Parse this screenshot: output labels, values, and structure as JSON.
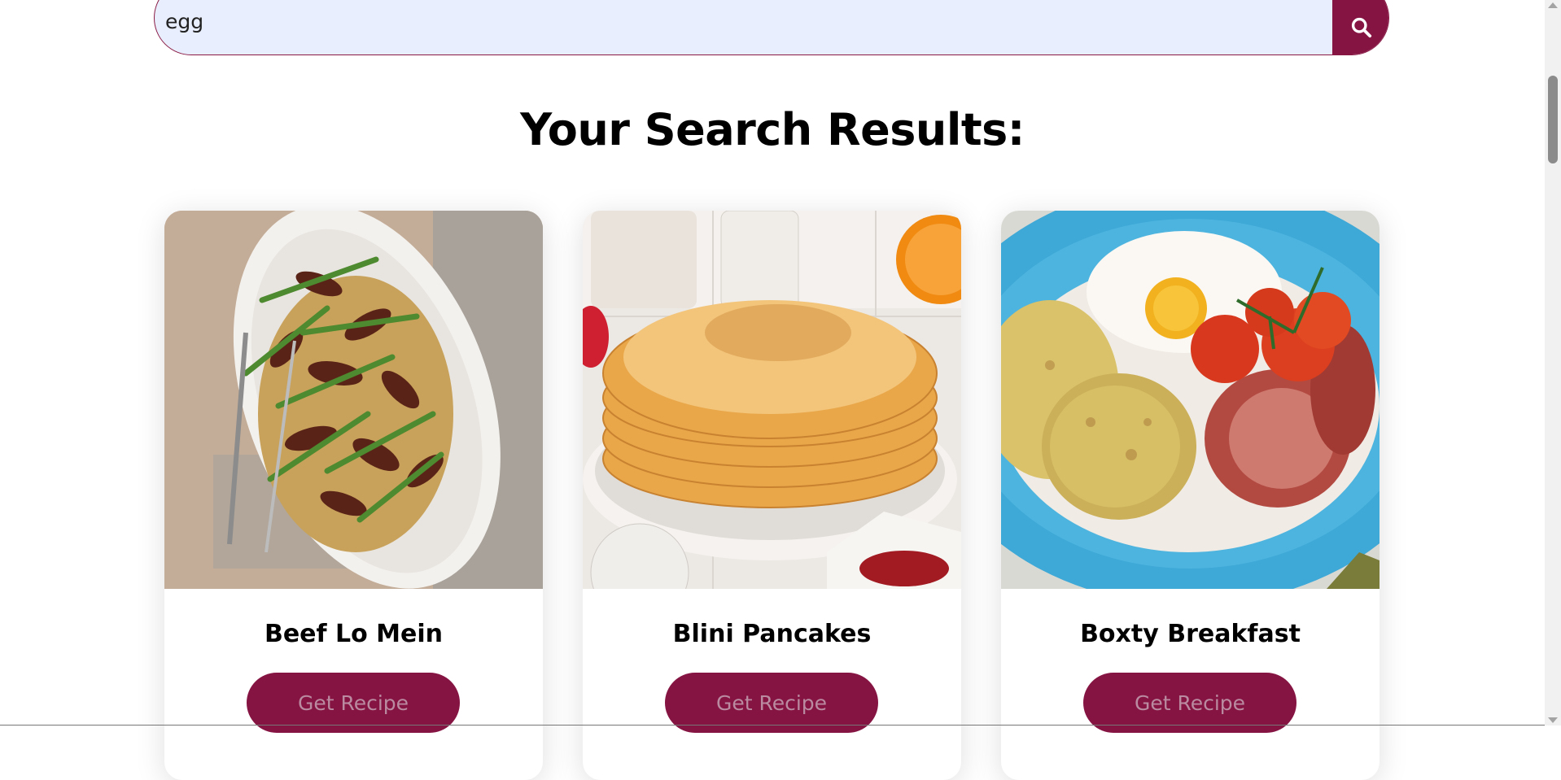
{
  "search": {
    "value": "egg",
    "button_icon": "search-icon"
  },
  "page": {
    "title": "Your Search Results:"
  },
  "results": [
    {
      "title": "Beef Lo Mein",
      "button_label": "Get Recipe"
    },
    {
      "title": "Blini Pancakes",
      "button_label": "Get Recipe"
    },
    {
      "title": "Boxty Breakfast",
      "button_label": "Get Recipe"
    }
  ],
  "colors": {
    "accent": "#861443",
    "search_bg": "#e8eefd"
  }
}
